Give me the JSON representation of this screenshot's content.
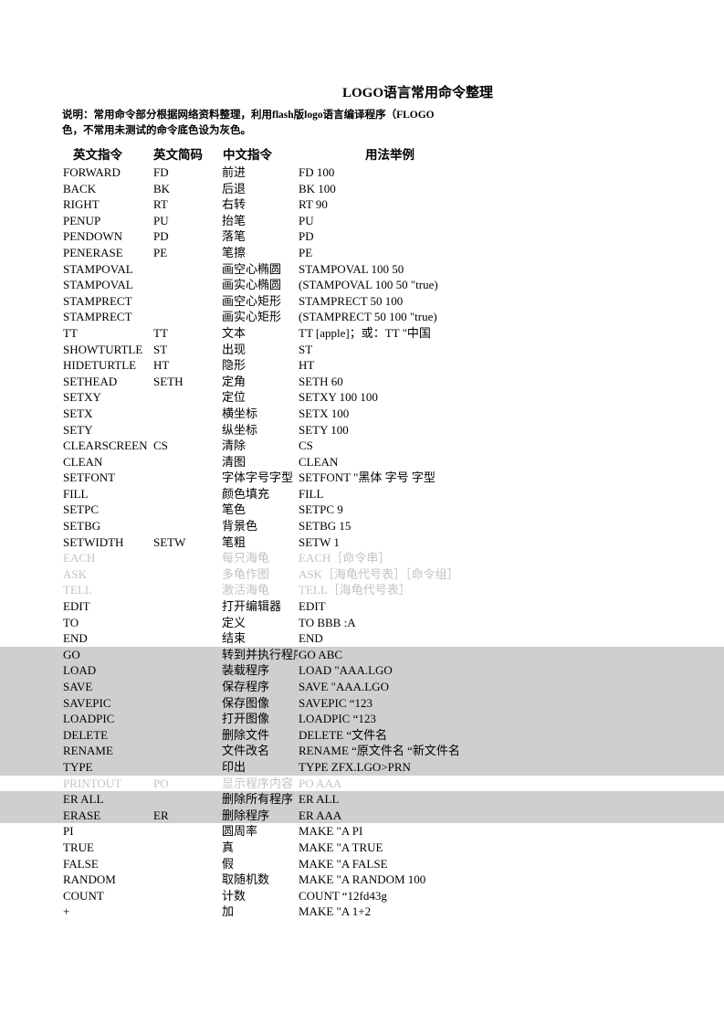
{
  "document": {
    "title": "LOGO语言常用命令整理",
    "description_lines": [
      "说明：常用命令部分根据网络资料整理，利用flash版logo语言编译程序（FLOGO",
      "色，不常用未测试的命令底色设为灰色。"
    ]
  },
  "colors": {
    "page_background": "#ffffff",
    "text": "#000000",
    "shaded_row_background": "#cfcfcf",
    "faded_text": "#c3c3c3"
  },
  "table": {
    "headers": {
      "english_command": "英文指令",
      "english_shortcode": "英文简码",
      "chinese_command": "中文指令",
      "usage_example": "用法举例"
    },
    "rows": [
      {
        "en": "FORWARD",
        "code": "FD",
        "cn": "前进",
        "ex": "FD 100",
        "style": "normal"
      },
      {
        "en": "BACK",
        "code": "BK",
        "cn": "后退",
        "ex": "BK 100",
        "style": "normal"
      },
      {
        "en": "RIGHT",
        "code": "RT",
        "cn": "右转",
        "ex": "RT 90",
        "style": "normal"
      },
      {
        "en": "PENUP",
        "code": "PU",
        "cn": "抬笔",
        "ex": "PU",
        "style": "normal"
      },
      {
        "en": "PENDOWN",
        "code": "PD",
        "cn": "落笔",
        "ex": "PD",
        "style": "normal"
      },
      {
        "en": "PENERASE",
        "code": "PE",
        "cn": "笔擦",
        "ex": "PE",
        "style": "normal"
      },
      {
        "en": "STAMPOVAL",
        "code": "",
        "cn": "画空心椭圆",
        "ex": "STAMPOVAL 100 50",
        "style": "normal"
      },
      {
        "en": "STAMPOVAL",
        "code": "",
        "cn": "画实心椭圆",
        "ex": "(STAMPOVAL 100 50 \"true)",
        "style": "normal"
      },
      {
        "en": "STAMPRECT",
        "code": "",
        "cn": "画空心矩形",
        "ex": "STAMPRECT 50 100",
        "style": "normal"
      },
      {
        "en": "STAMPRECT",
        "code": "",
        "cn": "画实心矩形",
        "ex": "(STAMPRECT 50 100 \"true)",
        "style": "normal"
      },
      {
        "en": "TT",
        "code": "TT",
        "cn": "文本",
        "ex": "TT [apple]；或：TT \"中国",
        "style": "normal"
      },
      {
        "en": "SHOWTURTLE",
        "code": "ST",
        "cn": "出现",
        "ex": "ST",
        "style": "normal"
      },
      {
        "en": "HIDETURTLE",
        "code": "HT",
        "cn": "隐形",
        "ex": "HT",
        "style": "normal"
      },
      {
        "en": "SETHEAD",
        "code": "SETH",
        "cn": "定角",
        "ex": "SETH 60",
        "style": "normal"
      },
      {
        "en": "SETXY",
        "code": "",
        "cn": "定位",
        "ex": "SETXY 100 100",
        "style": "normal"
      },
      {
        "en": "SETX",
        "code": "",
        "cn": "横坐标",
        "ex": "SETX 100",
        "style": "normal"
      },
      {
        "en": "SETY",
        "code": "",
        "cn": "纵坐标",
        "ex": "SETY 100",
        "style": "normal"
      },
      {
        "en": "CLEARSCREEN",
        "code": "CS",
        "cn": "清除",
        "ex": "CS",
        "style": "normal"
      },
      {
        "en": "CLEAN",
        "code": "",
        "cn": "清图",
        "ex": "CLEAN",
        "style": "normal"
      },
      {
        "en": "SETFONT",
        "code": "",
        "cn": "字体字号字型",
        "ex": "SETFONT \"黑体 字号 字型",
        "style": "normal"
      },
      {
        "en": "FILL",
        "code": "",
        "cn": "颜色填充",
        "ex": "FILL",
        "style": "normal"
      },
      {
        "en": "SETPC",
        "code": "",
        "cn": "笔色",
        "ex": "SETPC 9",
        "style": "normal"
      },
      {
        "en": "SETBG",
        "code": "",
        "cn": "背景色",
        "ex": "SETBG 15",
        "style": "normal"
      },
      {
        "en": "SETWIDTH",
        "code": "SETW",
        "cn": "笔粗",
        "ex": "SETW 1",
        "style": "normal"
      },
      {
        "en": "EACH",
        "code": "",
        "cn": "每只海龟",
        "ex": "EACH［命令串］",
        "style": "faded"
      },
      {
        "en": "ASK",
        "code": "",
        "cn": "多龟作图",
        "ex": "ASK［海龟代号表］［命令组］",
        "style": "faded"
      },
      {
        "en": "TELL",
        "code": "",
        "cn": "激活海龟",
        "ex": "TELL［海龟代号表］",
        "style": "faded"
      },
      {
        "en": "EDIT",
        "code": "",
        "cn": "打开编辑器",
        "ex": "EDIT",
        "style": "normal"
      },
      {
        "en": "TO",
        "code": "",
        "cn": "定义",
        "ex": "TO BBB :A",
        "style": "normal"
      },
      {
        "en": "END",
        "code": "",
        "cn": "结束",
        "ex": "END",
        "style": "normal"
      },
      {
        "en": "GO",
        "code": "",
        "cn": "转到并执行程序",
        "ex": "GO ABC",
        "style": "shaded"
      },
      {
        "en": "LOAD",
        "code": "",
        "cn": "装载程序",
        "ex": "LOAD \"AAA.LGO",
        "style": "shaded"
      },
      {
        "en": "SAVE",
        "code": "",
        "cn": "保存程序",
        "ex": "SAVE \"AAA.LGO",
        "style": "shaded"
      },
      {
        "en": "SAVEPIC",
        "code": "",
        "cn": "保存图像",
        "ex": "SAVEPIC “123",
        "style": "shaded"
      },
      {
        "en": "LOADPIC",
        "code": "",
        "cn": "打开图像",
        "ex": "LOADPIC “123",
        "style": "shaded"
      },
      {
        "en": "DELETE",
        "code": "",
        "cn": "删除文件",
        "ex": "DELETE “文件名",
        "style": "shaded"
      },
      {
        "en": "RENAME",
        "code": "",
        "cn": "文件改名",
        "ex": "RENAME “原文件名 “新文件名",
        "style": "shaded"
      },
      {
        "en": "TYPE",
        "code": "",
        "cn": "印出",
        "ex": "TYPE ZFX.LGO>PRN",
        "style": "shaded"
      },
      {
        "en": "PRINTOUT",
        "code": "PO",
        "cn": "显示程序内容",
        "ex": "PO AAA",
        "style": "faded"
      },
      {
        "en": "ER ALL",
        "code": "",
        "cn": "删除所有程序",
        "ex": "ER ALL",
        "style": "shaded"
      },
      {
        "en": "ERASE",
        "code": "ER",
        "cn": "删除程序",
        "ex": "ER AAA",
        "style": "shaded"
      },
      {
        "en": "PI",
        "code": "",
        "cn": "圆周率",
        "ex": "MAKE \"A PI",
        "style": "normal"
      },
      {
        "en": "TRUE",
        "code": "",
        "cn": "真",
        "ex": "MAKE \"A TRUE",
        "style": "normal"
      },
      {
        "en": "FALSE",
        "code": "",
        "cn": "假",
        "ex": "MAKE \"A FALSE",
        "style": "normal"
      },
      {
        "en": "RANDOM",
        "code": "",
        "cn": "取随机数",
        "ex": "MAKE \"A RANDOM 100",
        "style": "normal"
      },
      {
        "en": "COUNT",
        "code": "",
        "cn": "计数",
        "ex": "COUNT “12fd43g",
        "style": "normal"
      },
      {
        "en": "+",
        "code": "",
        "cn": "加",
        "ex": "MAKE \"A 1+2",
        "style": "normal"
      }
    ]
  }
}
